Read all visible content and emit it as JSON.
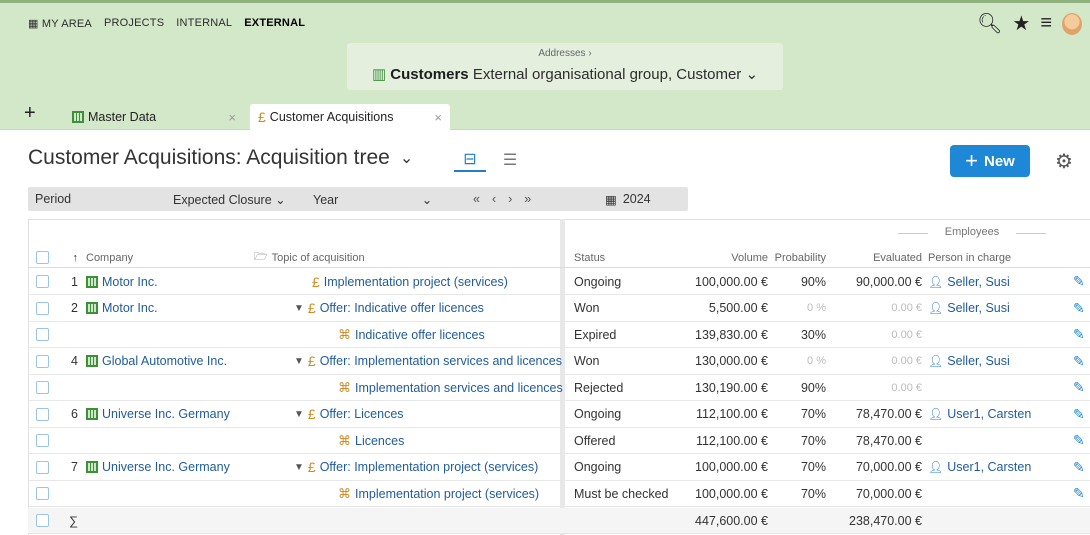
{
  "nav": {
    "items": [
      "MY AREA",
      "PROJECTS",
      "INTERNAL",
      "EXTERNAL"
    ],
    "active_index": 3
  },
  "header_icons": [
    "search-icon",
    "star-icon",
    "menu-icon",
    "avatar"
  ],
  "address": {
    "crumb": "Addresses ›",
    "title_bold": "Customers",
    "title_rest": "External organisational group, Customer"
  },
  "tabs": [
    {
      "label": "Master Data",
      "icon": "building-icon"
    },
    {
      "label": "Customer Acquisitions",
      "icon": "coin-icon"
    }
  ],
  "page": {
    "title": "Customer Acquisitions: Acquisition tree",
    "new_label": "New"
  },
  "filter": {
    "period_label": "Period",
    "expected": "Expected Closure",
    "year": "Year",
    "date": "2024"
  },
  "table": {
    "group_header": "Employees",
    "columns": {
      "company": "Company",
      "topic": "Topic of acquisition",
      "status": "Status",
      "volume": "Volume",
      "probability": "Probability",
      "evaluated": "Evaluated",
      "person": "Person in charge"
    },
    "rows": [
      {
        "num": "1",
        "company": "Motor Inc.",
        "topic": "Implementation project (services)",
        "level": 0,
        "expand": false,
        "status": "Ongoing",
        "volume": "100,000.00 €",
        "probability": "90%",
        "evaluated": "90,000.00 €",
        "person": "Seller, Susi"
      },
      {
        "num": "2",
        "company": "Motor Inc.",
        "topic": "Offer: Indicative offer licences",
        "level": 0,
        "expand": true,
        "status": "Won",
        "volume": "5,500.00 €",
        "probability": "0 %",
        "evaluated": "0.00 €",
        "person": "Seller, Susi"
      },
      {
        "num": "",
        "company": "",
        "topic": "Indicative offer licences",
        "level": 1,
        "expand": false,
        "status": "Expired",
        "volume": "139,830.00 €",
        "probability": "30%",
        "evaluated": "0.00 €",
        "person": ""
      },
      {
        "num": "4",
        "company": "Global Automotive Inc.",
        "topic": "Offer: Implementation services and licences",
        "level": 0,
        "expand": true,
        "status": "Won",
        "volume": "130,000.00 €",
        "probability": "0 %",
        "evaluated": "0.00 €",
        "person": "Seller, Susi"
      },
      {
        "num": "",
        "company": "",
        "topic": "Implementation services and licences",
        "level": 1,
        "expand": false,
        "status": "Rejected",
        "volume": "130,190.00 €",
        "probability": "90%",
        "evaluated": "0.00 €",
        "person": ""
      },
      {
        "num": "6",
        "company": "Universe Inc. Germany",
        "topic": "Offer: Licences",
        "level": 0,
        "expand": true,
        "status": "Ongoing",
        "volume": "112,100.00 €",
        "probability": "70%",
        "evaluated": "78,470.00 €",
        "person": "User1, Carsten"
      },
      {
        "num": "",
        "company": "",
        "topic": "Licences",
        "level": 1,
        "expand": false,
        "status": "Offered",
        "volume": "112,100.00 €",
        "probability": "70%",
        "evaluated": "78,470.00 €",
        "person": ""
      },
      {
        "num": "7",
        "company": "Universe Inc. Germany",
        "topic": "Offer: Implementation project (services)",
        "level": 0,
        "expand": true,
        "status": "Ongoing",
        "volume": "100,000.00 €",
        "probability": "70%",
        "evaluated": "70,000.00 €",
        "person": "User1, Carsten"
      },
      {
        "num": "",
        "company": "",
        "topic": "Implementation project (services)",
        "level": 1,
        "expand": false,
        "status": "Must be checked",
        "volume": "100,000.00 €",
        "probability": "70%",
        "evaluated": "70,000.00 €",
        "person": ""
      }
    ],
    "sum": {
      "symbol": "∑",
      "volume": "447,600.00 €",
      "evaluated": "238,470.00 €"
    }
  }
}
